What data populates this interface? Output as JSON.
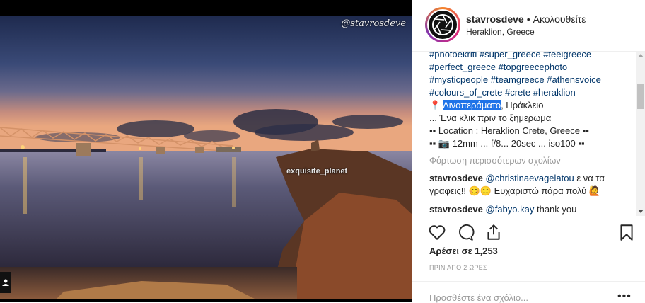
{
  "photo": {
    "watermark_top": "@stavrosdeve",
    "watermark_mid": "exquisite_planet"
  },
  "header": {
    "username": "stavrosdeve",
    "separator": "•",
    "follow_status": "Ακολουθείτε",
    "location": "Heraklion, Greece"
  },
  "caption": {
    "hashtags_line1": [
      "#photoekriti",
      "#super_greece",
      "#feelgreece"
    ],
    "hashtags_line2": [
      "#perfect_greece",
      "#topgreecephoto"
    ],
    "hashtags_line3": [
      "#mysticpeople",
      "#teamgreece",
      "#athensvoice"
    ],
    "hashtags_line4": [
      "#colours_of_crete",
      "#crete",
      "#heraklion"
    ],
    "pin_emoji": "📍",
    "place_highlighted": "Λινοπεράματο",
    "place_rest": ", Ηράκλειο",
    "line_dawn": "... Ένα κλικ πριν το ξημερωμα",
    "line_location": "▪▪ Location : Heraklion Crete, Greece ▪▪",
    "camera_emoji": "📷",
    "line_settings_prefix": "▪▪",
    "line_settings": "12mm ... f/8... 20sec ... iso100 ▪▪"
  },
  "load_more": "Φόρτωση περισσότερων σχολίων",
  "comments": [
    {
      "user": "stavrosdeve",
      "mention": "@christinaevagelatou",
      "text": " ε να τα γραφεις!! 😊🙂 Ευχαριστώ πάρα πολύ 🙋"
    },
    {
      "user": "stavrosdeve",
      "mention": "@fabyo.kay",
      "text": " thank you"
    }
  ],
  "actions": {
    "icons": [
      "heart-icon",
      "comment-icon",
      "share-icon",
      "bookmark-icon"
    ]
  },
  "likes": "Αρέσει σε 1,253",
  "timestamp": "ΠΡΙΝ ΑΠΟ 2 ΩΡΕΣ",
  "add_comment_placeholder": "Προσθέστε ένα σχόλιο...",
  "more_options": "•••"
}
